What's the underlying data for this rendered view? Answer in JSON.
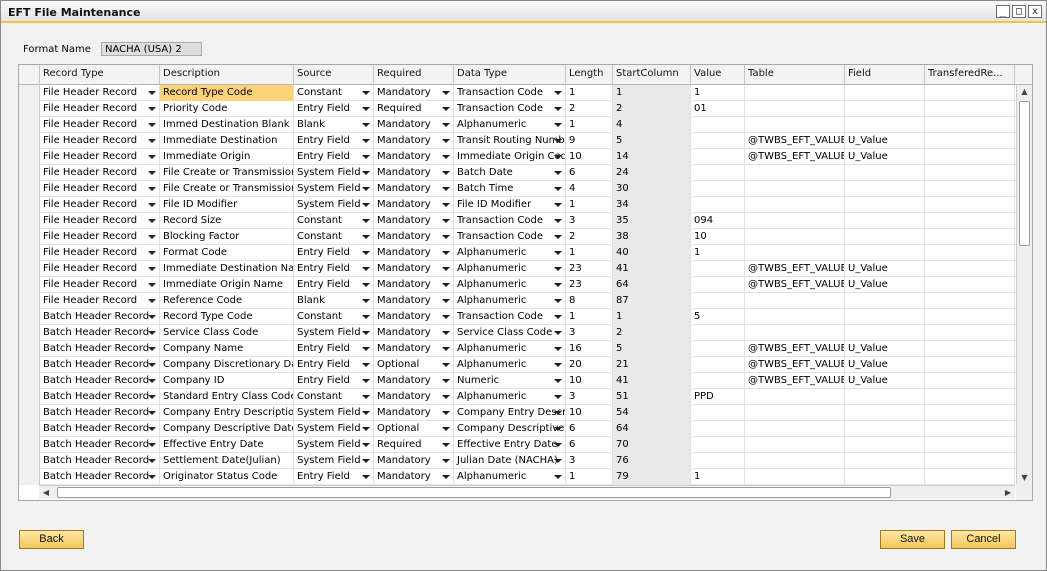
{
  "window": {
    "title": "EFT File Maintenance",
    "controls": [
      "_",
      "□",
      "x"
    ]
  },
  "format": {
    "label": "Format Name",
    "value": "NACHA (USA) 2"
  },
  "grid": {
    "columns": [
      "",
      "Record Type",
      "Description",
      "Source",
      "Required",
      "Data Type",
      "Length",
      "StartColumn",
      "Value",
      "Table",
      "Field",
      "TransferedRe..."
    ],
    "rows": [
      [
        "File Header Record",
        "Record Type Code",
        "Constant",
        "Mandatory",
        "Transaction Code",
        "1",
        "1",
        "1",
        "",
        ""
      ],
      [
        "File Header Record",
        "Priority Code",
        "Entry Field",
        "Required",
        "Transaction Code",
        "2",
        "2",
        "01",
        "",
        ""
      ],
      [
        "File Header Record",
        "Immed Destination Blank",
        "Blank",
        "Mandatory",
        "Alphanumeric",
        "1",
        "4",
        "",
        "",
        ""
      ],
      [
        "File Header Record",
        "Immediate Destination",
        "Entry Field",
        "Mandatory",
        "Transit Routing Number",
        "9",
        "5",
        "",
        "@TWBS_EFT_VALUES",
        "U_Value"
      ],
      [
        "File Header Record",
        "Immediate Origin",
        "Entry Field",
        "Mandatory",
        "Immediate Origin Code",
        "10",
        "14",
        "",
        "@TWBS_EFT_VALUES",
        "U_Value"
      ],
      [
        "File Header Record",
        "File Create or Transmission Date",
        "System Field",
        "Mandatory",
        "Batch Date",
        "6",
        "24",
        "",
        "",
        ""
      ],
      [
        "File Header Record",
        "File Create or Transmission Time",
        "System Field",
        "Mandatory",
        "Batch Time",
        "4",
        "30",
        "",
        "",
        ""
      ],
      [
        "File Header Record",
        "File ID Modifier",
        "System Field",
        "Mandatory",
        "File ID Modifier",
        "1",
        "34",
        "",
        "",
        ""
      ],
      [
        "File Header Record",
        "Record Size",
        "Constant",
        "Mandatory",
        "Transaction Code",
        "3",
        "35",
        "094",
        "",
        ""
      ],
      [
        "File Header Record",
        "Blocking Factor",
        "Constant",
        "Mandatory",
        "Transaction Code",
        "2",
        "38",
        "10",
        "",
        ""
      ],
      [
        "File Header Record",
        "Format Code",
        "Entry Field",
        "Mandatory",
        "Alphanumeric",
        "1",
        "40",
        "1",
        "",
        ""
      ],
      [
        "File Header Record",
        "Immediate Destination Name",
        "Entry Field",
        "Mandatory",
        "Alphanumeric",
        "23",
        "41",
        "",
        "@TWBS_EFT_VALUES",
        "U_Value"
      ],
      [
        "File Header Record",
        "Immediate Origin Name",
        "Entry Field",
        "Mandatory",
        "Alphanumeric",
        "23",
        "64",
        "",
        "@TWBS_EFT_VALUES",
        "U_Value"
      ],
      [
        "File Header Record",
        "Reference Code",
        "Blank",
        "Mandatory",
        "Alphanumeric",
        "8",
        "87",
        "",
        "",
        ""
      ],
      [
        "Batch Header Record",
        "Record Type Code",
        "Constant",
        "Mandatory",
        "Transaction Code",
        "1",
        "1",
        "5",
        "",
        ""
      ],
      [
        "Batch Header Record",
        "Service Class Code",
        "System Field",
        "Mandatory",
        "Service Class Code",
        "3",
        "2",
        "",
        "",
        ""
      ],
      [
        "Batch Header Record",
        "Company Name",
        "Entry Field",
        "Mandatory",
        "Alphanumeric",
        "16",
        "5",
        "",
        "@TWBS_EFT_VALUES",
        "U_Value"
      ],
      [
        "Batch Header Record",
        "Company Discretionary Data",
        "Entry Field",
        "Optional",
        "Alphanumeric",
        "20",
        "21",
        "",
        "@TWBS_EFT_VALUES",
        "U_Value"
      ],
      [
        "Batch Header Record",
        "Company ID",
        "Entry Field",
        "Mandatory",
        "Numeric",
        "10",
        "41",
        "",
        "@TWBS_EFT_VALUES",
        "U_Value"
      ],
      [
        "Batch Header Record",
        "Standard Entry Class Code",
        "Constant",
        "Mandatory",
        "Alphanumeric",
        "3",
        "51",
        "PPD",
        "",
        ""
      ],
      [
        "Batch Header Record",
        "Company Entry Description",
        "System Field",
        "Mandatory",
        "Company Entry Description",
        "10",
        "54",
        "",
        "",
        ""
      ],
      [
        "Batch Header Record",
        "Company Descriptive Date",
        "System Field",
        "Optional",
        "Company Descriptive Date",
        "6",
        "64",
        "",
        "",
        ""
      ],
      [
        "Batch Header Record",
        "Effective Entry Date",
        "System Field",
        "Required",
        "Effective Entry Date",
        "6",
        "70",
        "",
        "",
        ""
      ],
      [
        "Batch Header Record",
        "Settlement Date(Julian)",
        "System Field",
        "Mandatory",
        "Julian Date (NACHA)",
        "3",
        "76",
        "",
        "",
        ""
      ],
      [
        "Batch Header Record",
        "Originator Status Code",
        "Entry Field",
        "Mandatory",
        "Alphanumeric",
        "1",
        "79",
        "1",
        "",
        ""
      ]
    ]
  },
  "buttons": {
    "back": "Back",
    "save": "Save",
    "cancel": "Cancel"
  }
}
